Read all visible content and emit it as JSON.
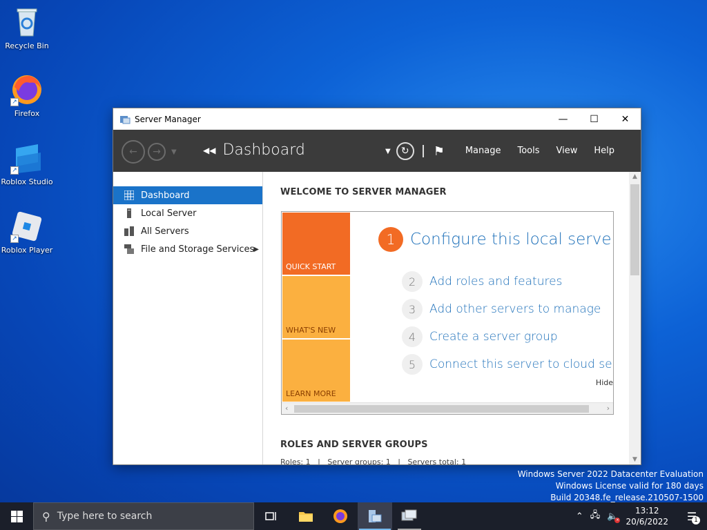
{
  "desktop": {
    "icons": [
      {
        "label": "Recycle Bin"
      },
      {
        "label": "Firefox"
      },
      {
        "label": "Roblox Studio"
      },
      {
        "label": "Roblox Player"
      }
    ],
    "watermark": [
      "Windows Server 2022 Datacenter Evaluation",
      "Windows License valid for 180 days",
      "Build 20348.fe_release.210507-1500"
    ]
  },
  "window": {
    "title": "Server Manager",
    "breadcrumb": "Dashboard",
    "menu": [
      "Manage",
      "Tools",
      "View",
      "Help"
    ],
    "sidebar": [
      {
        "label": "Dashboard",
        "active": true,
        "icon": "dashboard-icon"
      },
      {
        "label": "Local Server",
        "icon": "server-icon"
      },
      {
        "label": "All Servers",
        "icon": "servers-icon"
      },
      {
        "label": "File and Storage Services",
        "icon": "storage-icon",
        "has_submenu": true
      }
    ],
    "welcome": {
      "heading": "WELCOME TO SERVER MANAGER",
      "tiles": [
        "QUICK START",
        "WHAT'S NEW",
        "LEARN MORE"
      ],
      "steps": [
        {
          "num": "1",
          "text": "Configure this local server"
        },
        {
          "num": "2",
          "text": "Add roles and features"
        },
        {
          "num": "3",
          "text": "Add other servers to manage"
        },
        {
          "num": "4",
          "text": "Create a server group"
        },
        {
          "num": "5",
          "text": "Connect this server to cloud servic"
        }
      ],
      "hide": "Hide"
    },
    "roles": {
      "heading": "ROLES AND SERVER GROUPS",
      "meta": "Roles: 1   |   Server groups: 1   |   Servers total: 1"
    }
  },
  "taskbar": {
    "search_placeholder": "Type here to search",
    "time": "13:12",
    "date": "20/6/2022",
    "notification_count": "1"
  },
  "colors": {
    "accent": "#1a73c9",
    "quick_start": "#f26b24",
    "tile_light": "#fbb040"
  }
}
